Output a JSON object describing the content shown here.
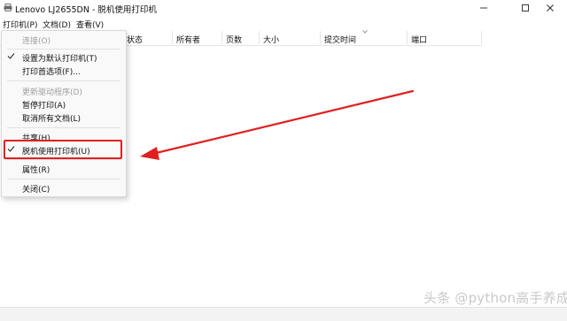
{
  "window": {
    "title": "Lenovo LJ2655DN  - 脱机使用打印机"
  },
  "menubar": {
    "items": [
      "打印机(P)",
      "文档(D)",
      "查看(V)"
    ]
  },
  "columns": [
    "状态",
    "所有者",
    "页数",
    "大小",
    "提交时间",
    "端口"
  ],
  "printer_menu": {
    "items": [
      {
        "label": "连接(O)",
        "disabled": true,
        "checked": false
      },
      {
        "label": "设置为默认打印机(T)",
        "disabled": false,
        "checked": true
      },
      {
        "label": "打印首选项(F)...",
        "disabled": false,
        "checked": false
      },
      {
        "label": "更新驱动程序(D)",
        "disabled": true,
        "checked": false
      },
      {
        "label": "暂停打印(A)",
        "disabled": false,
        "checked": false
      },
      {
        "label": "取消所有文档(L)",
        "disabled": false,
        "checked": false
      },
      {
        "label": "共享(H)...",
        "disabled": false,
        "checked": false
      },
      {
        "label": "脱机使用打印机(U)",
        "disabled": false,
        "checked": true
      },
      {
        "label": "属性(R)",
        "disabled": false,
        "checked": false
      },
      {
        "label": "关闭(C)",
        "disabled": false,
        "checked": false
      }
    ]
  },
  "watermark": "头条 @python高手养成",
  "colors": {
    "highlight": "#e02020",
    "arrow": "#e02020",
    "disabled_text": "#a0a0a0"
  }
}
